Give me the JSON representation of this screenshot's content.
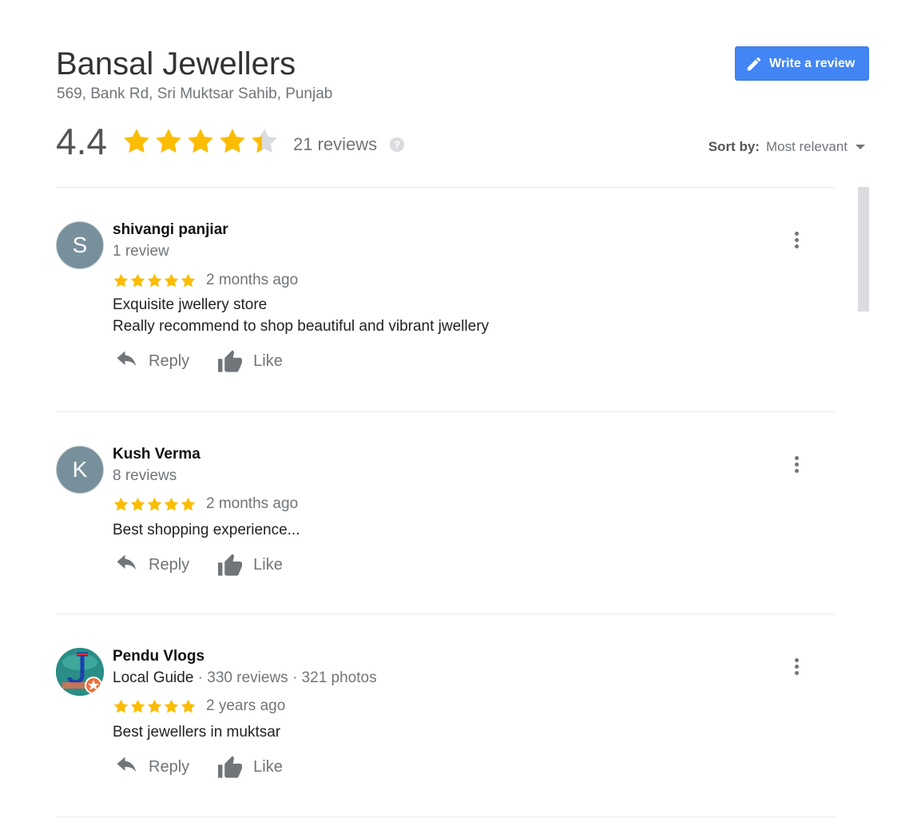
{
  "business": {
    "name": "Bansal Jewellers",
    "address": "569, Bank Rd, Sri Muktsar Sahib, Punjab",
    "rating": "4.4",
    "rating_value": 4.4,
    "reviews_count": "21 reviews",
    "write_review_label": "Write a review"
  },
  "sort": {
    "label": "Sort by:",
    "value": "Most relevant"
  },
  "colors": {
    "accent": "#4285f4",
    "star": "#fbbc04",
    "star_empty": "#dadce0"
  },
  "reviews": [
    {
      "initial": "S",
      "name": "shivangi panjiar",
      "meta": "1 review",
      "stars": 5,
      "time": "2 months ago",
      "text_lines": [
        "Exquisite jwellery store",
        "Really recommend to shop beautiful and vibrant jwellery"
      ],
      "reply_label": "Reply",
      "like_label": "Like"
    },
    {
      "initial": "K",
      "name": "Kush Verma",
      "meta": "8 reviews",
      "stars": 5,
      "time": "2 months ago",
      "text_lines": [
        "Best shopping experience..."
      ],
      "reply_label": "Reply",
      "like_label": "Like"
    },
    {
      "initial": "",
      "name": "Pendu Vlogs",
      "meta_guide": "Local Guide",
      "meta": " · 330 reviews · 321 photos",
      "stars": 5,
      "time": "2 years ago",
      "text_lines": [
        "Best jewellers in muktsar"
      ],
      "reply_label": "Reply",
      "like_label": "Like"
    }
  ]
}
